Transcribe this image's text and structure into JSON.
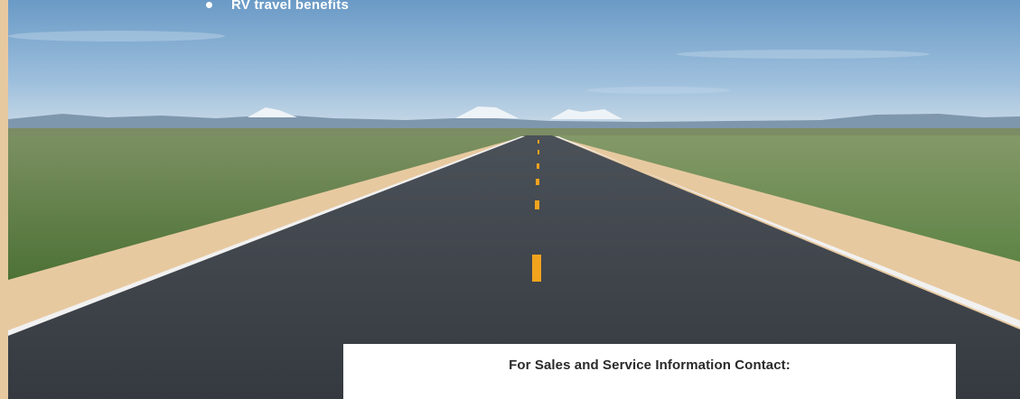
{
  "bullet_list": {
    "items": [
      {
        "label": "RV travel benefits"
      }
    ]
  },
  "contact": {
    "heading": "For Sales and Service Information Contact:"
  },
  "colors": {
    "page_tan": "#e7c9a0",
    "sky_top": "#6f9fca",
    "sky_bottom": "#c9dbe8",
    "grass": "#5e7f45",
    "road": "#3e444b",
    "lane_yellow": "#f2a31e",
    "edge_line": "#f4f4f4",
    "box_white": "#ffffff",
    "heading_text": "#2a2a2a"
  },
  "icons": {
    "bullet": "filled-circle-bullet-icon"
  }
}
